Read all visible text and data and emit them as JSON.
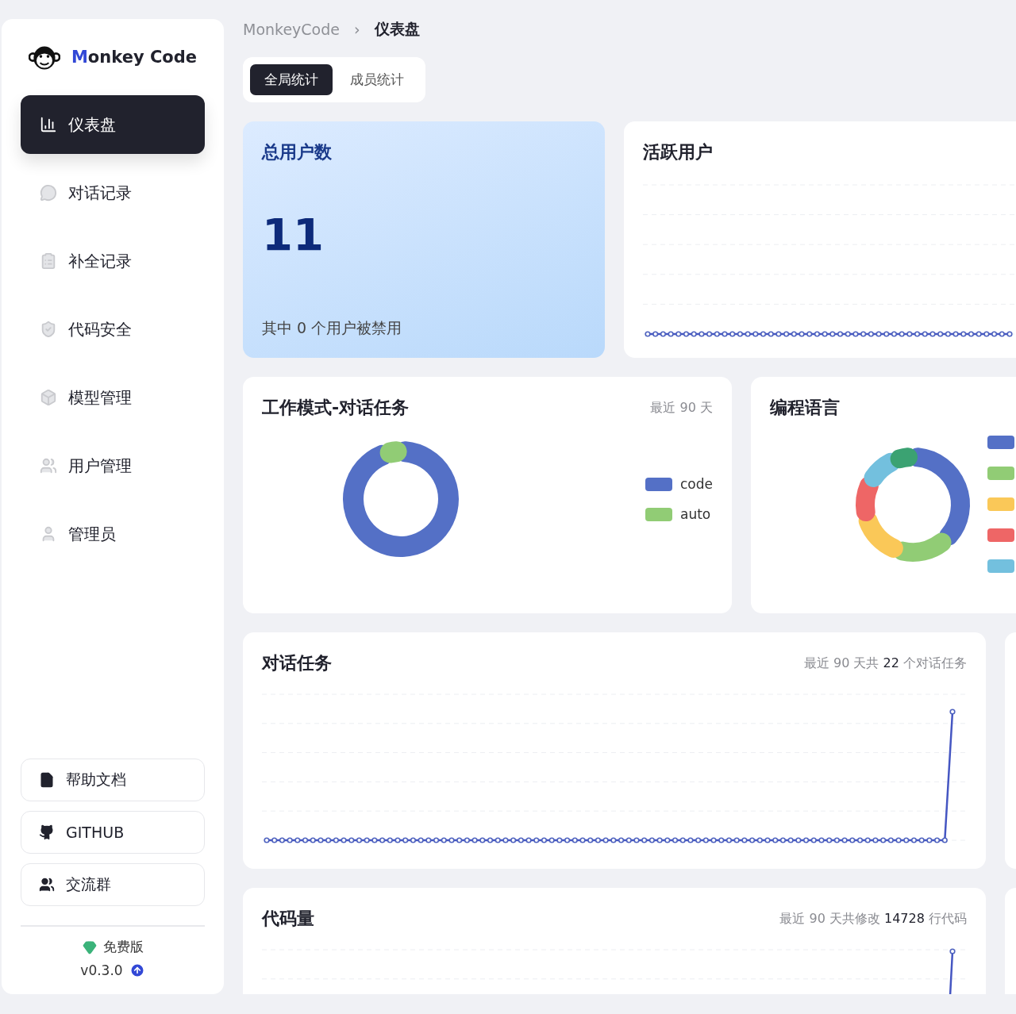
{
  "brand": {
    "initial": "M",
    "rest": "onkey Code"
  },
  "nav": [
    {
      "label": "仪表盘",
      "selected": true
    },
    {
      "label": "对话记录",
      "selected": false
    },
    {
      "label": "补全记录",
      "selected": false
    },
    {
      "label": "代码安全",
      "selected": false
    },
    {
      "label": "模型管理",
      "selected": false
    },
    {
      "label": "用户管理",
      "selected": false
    },
    {
      "label": "管理员",
      "selected": false
    }
  ],
  "links": [
    "帮助文档",
    "GITHUB",
    "交流群"
  ],
  "edition": "免费版",
  "version": "v0.3.0",
  "breadcrumb": [
    "MonkeyCode",
    "›",
    "仪表盘"
  ],
  "tabs": [
    {
      "label": "全局统计",
      "selected": true
    },
    {
      "label": "成员统计",
      "selected": false
    }
  ],
  "total_users": {
    "title": "总用户数",
    "value": "11",
    "note": "其中 0 个用户被禁用"
  },
  "active_users": {
    "title": "活跃用户"
  },
  "work_mode": {
    "title": "工作模式-对话任务",
    "period": "最近 90 天",
    "legend": [
      {
        "label": "code",
        "color": "#5470c6"
      },
      {
        "label": "auto",
        "color": "#91cc75"
      }
    ]
  },
  "languages": {
    "title": "编程语言",
    "legend": [
      {
        "color": "#5470c6"
      },
      {
        "color": "#91cc75"
      },
      {
        "color": "#fac858"
      },
      {
        "color": "#ee6666"
      },
      {
        "color": "#73c0de"
      }
    ]
  },
  "tasks": {
    "title": "对话任务",
    "summary": "最近 90 天共 **22** 个对话任务"
  },
  "code_lines": {
    "title": "代码量",
    "summary": "最近 90 天共修改 **14728** 行代码"
  }
}
